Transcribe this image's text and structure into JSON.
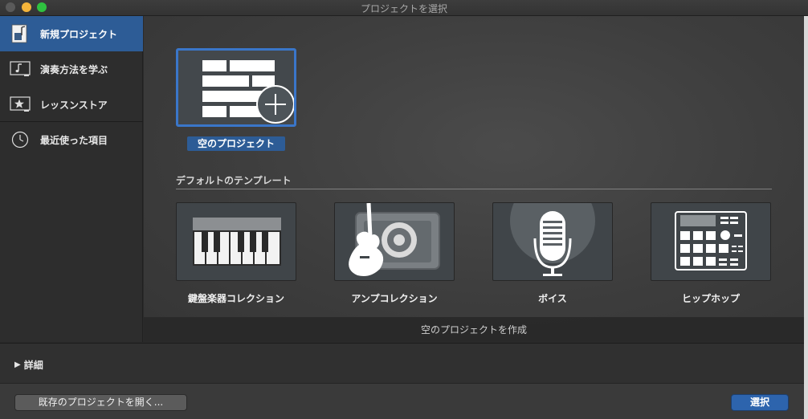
{
  "window": {
    "title": "プロジェクトを選択"
  },
  "sidebar": {
    "items": [
      {
        "label": "新規プロジェクト",
        "icon": "new-project-icon",
        "selected": true
      },
      {
        "label": "演奏方法を学ぶ",
        "icon": "learn-to-play-icon",
        "selected": false
      },
      {
        "label": "レッスンストア",
        "icon": "lesson-store-icon",
        "selected": false
      },
      {
        "label": "最近使った項目",
        "icon": "clock-icon",
        "selected": false
      }
    ]
  },
  "main": {
    "empty_project_label": "空のプロジェクト",
    "section_title": "デフォルトのテンプレート",
    "templates": [
      {
        "label": "鍵盤楽器コレクション",
        "icon": "keyboard-icon"
      },
      {
        "label": "アンプコレクション",
        "icon": "guitar-amp-icon"
      },
      {
        "label": "ボイス",
        "icon": "microphone-icon"
      },
      {
        "label": "ヒップホップ",
        "icon": "drum-machine-icon"
      }
    ],
    "footer_text": "空のプロジェクトを作成"
  },
  "details": {
    "label": "詳細"
  },
  "buttons": {
    "open_existing": "既存のプロジェクトを開く...",
    "select": "選択"
  },
  "colors": {
    "accent": "#2d5c96",
    "selection_border": "#3a76c9",
    "close": "#5a5a5a",
    "minimize": "#f4b43a",
    "zoom": "#2fc240"
  }
}
